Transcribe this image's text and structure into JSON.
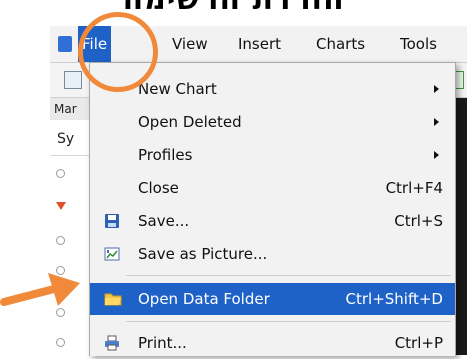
{
  "heading_fragment": "הורדת הרשימה",
  "colors": {
    "accent": "#1e62c8",
    "annotation": "#f08a3a",
    "menu_bg": "#f2f2f2"
  },
  "menubar": {
    "items": [
      {
        "label": "File"
      },
      {
        "label": "View"
      },
      {
        "label": "Insert"
      },
      {
        "label": "Charts"
      },
      {
        "label": "Tools"
      }
    ]
  },
  "market_panel": {
    "title": "Mar",
    "column_header": "Sy"
  },
  "file_menu": {
    "items": [
      {
        "label": "New Chart",
        "shortcut": "",
        "submenu": true,
        "icon": ""
      },
      {
        "label": "Open Deleted",
        "shortcut": "",
        "submenu": true,
        "icon": ""
      },
      {
        "label": "Profiles",
        "shortcut": "",
        "submenu": true,
        "icon": ""
      },
      {
        "label": "Close",
        "shortcut": "Ctrl+F4",
        "submenu": false,
        "icon": ""
      },
      {
        "label": "Save...",
        "shortcut": "Ctrl+S",
        "submenu": false,
        "icon": "save-icon"
      },
      {
        "label": "Save as Picture...",
        "shortcut": "",
        "submenu": false,
        "icon": "picture-icon"
      },
      {
        "label": "Open Data Folder",
        "shortcut": "Ctrl+Shift+D",
        "submenu": false,
        "icon": "folder-icon"
      },
      {
        "label": "Print...",
        "shortcut": "Ctrl+P",
        "submenu": false,
        "icon": "printer-icon"
      }
    ]
  }
}
